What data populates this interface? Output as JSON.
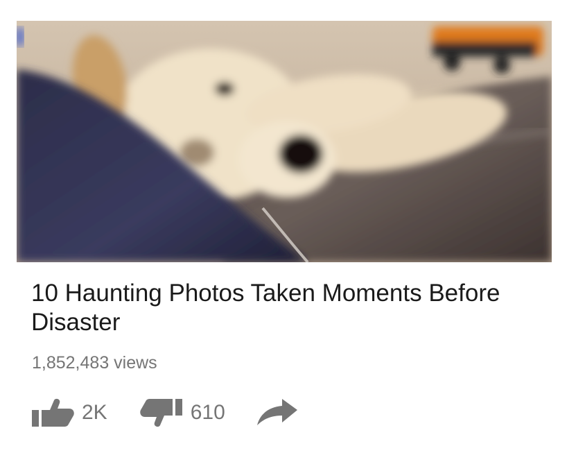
{
  "video": {
    "title": "10 Haunting Photos Taken Moments Before Disaster",
    "views": "1,852,483 views",
    "likes": "2K",
    "dislikes": "610"
  },
  "icons": {
    "like": "thumbs-up-icon",
    "dislike": "thumbs-down-icon",
    "share": "share-arrow-icon"
  },
  "colors": {
    "icon": "#757575",
    "title": "#1a1a1a",
    "meta": "#757575"
  }
}
